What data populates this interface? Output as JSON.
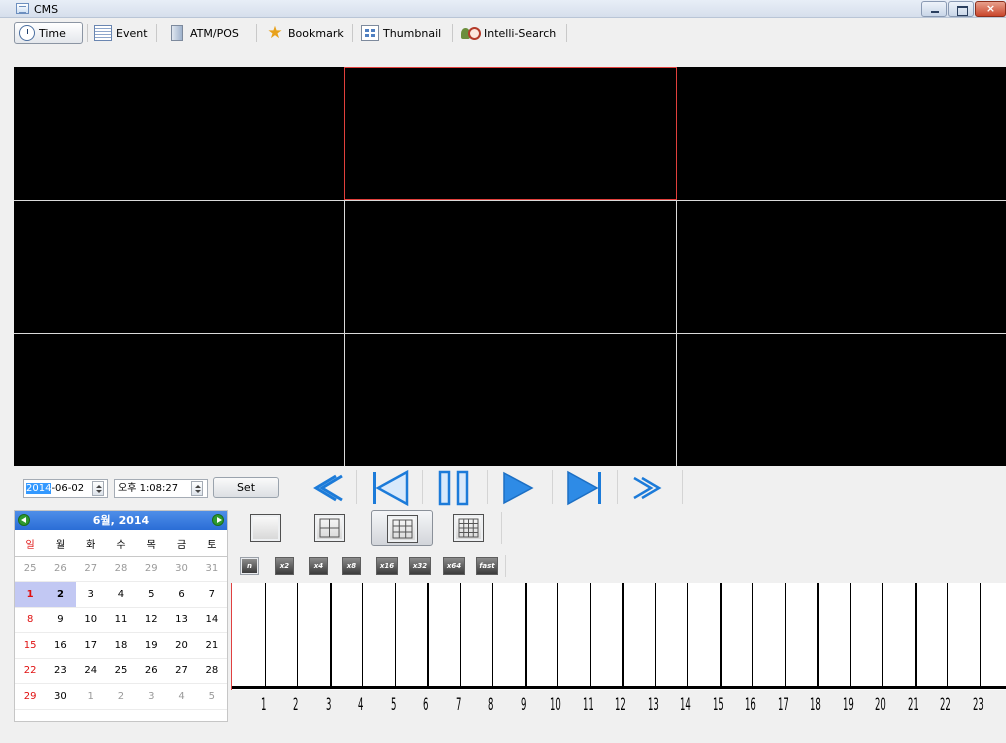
{
  "window": {
    "title": "CMS"
  },
  "toolbar": {
    "tabs": [
      {
        "label": "Time",
        "icon": "clock-icon",
        "active": true
      },
      {
        "label": "Event",
        "icon": "event-list-icon"
      },
      {
        "label": "ATM/POS",
        "icon": "atm-icon"
      },
      {
        "label": "Bookmark",
        "icon": "bookmark-icon"
      },
      {
        "label": "Thumbnail",
        "icon": "thumbnail-icon"
      },
      {
        "label": "Intelli-Search",
        "icon": "intelli-search-icon"
      }
    ]
  },
  "video": {
    "layout": "3x3",
    "selected_cell": 2,
    "cell_color": "#000000",
    "selection_color": "#e1403c"
  },
  "datetime": {
    "date_year": "2014",
    "date_rest": "-06-02",
    "time": "오후 1:08:27",
    "set_label": "Set"
  },
  "playback": {
    "buttons": [
      "rewind",
      "go-to-start",
      "pause",
      "play",
      "go-to-end",
      "fast-forward"
    ],
    "accent_color": "#1c7bd9"
  },
  "calendar": {
    "header": "6월, 2014",
    "weekdays": [
      "일",
      "월",
      "화",
      "수",
      "목",
      "금",
      "토"
    ],
    "weeks": [
      [
        "25",
        "26",
        "27",
        "28",
        "29",
        "30",
        "31"
      ],
      [
        "1",
        "2",
        "3",
        "4",
        "5",
        "6",
        "7"
      ],
      [
        "8",
        "9",
        "10",
        "11",
        "12",
        "13",
        "14"
      ],
      [
        "15",
        "16",
        "17",
        "18",
        "19",
        "20",
        "21"
      ],
      [
        "22",
        "23",
        "24",
        "25",
        "26",
        "27",
        "28"
      ],
      [
        "29",
        "30",
        "1",
        "2",
        "3",
        "4",
        "5"
      ]
    ],
    "selected_days": [
      "1",
      "2"
    ],
    "sunday_color": "#e01010",
    "header_color": "#2a6dd6"
  },
  "layouts": [
    "1x1",
    "2x2",
    "3x3",
    "4x4"
  ],
  "active_layout": "3x3",
  "speeds": [
    "n",
    "x2",
    "x4",
    "x8",
    "x16",
    "x32",
    "x64",
    "fast"
  ],
  "timeline": {
    "hour_labels": [
      "1",
      "2",
      "3",
      "4",
      "5",
      "6",
      "7",
      "8",
      "9",
      "10",
      "11",
      "12",
      "13",
      "14",
      "15",
      "16",
      "17",
      "18",
      "19",
      "20",
      "21",
      "22",
      "23"
    ]
  }
}
